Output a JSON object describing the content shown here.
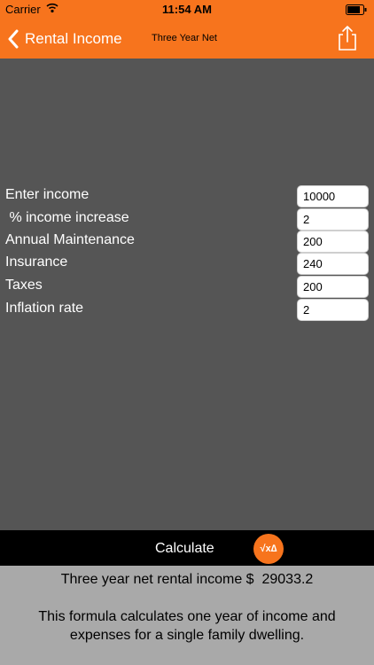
{
  "status_bar": {
    "carrier": "Carrier",
    "time": "11:54 AM"
  },
  "nav": {
    "back_label": "Rental Income",
    "title": "Three Year Net"
  },
  "form": {
    "rows": [
      {
        "label": "Enter income",
        "value": "10000"
      },
      {
        "label": " % income increase",
        "value": "2"
      },
      {
        "label": "Annual Maintenance",
        "value": "200"
      },
      {
        "label": "Insurance",
        "value": "240"
      },
      {
        "label": "Taxes",
        "value": "200"
      },
      {
        "label": "Inflation rate",
        "value": "2"
      }
    ]
  },
  "calculate": {
    "label": "Calculate",
    "icon_text": "√x∆"
  },
  "results": {
    "result_line": "Three year net rental income $  29033.2",
    "description": "This formula calculates one  year of income and expenses for a single family dwelling."
  },
  "colors": {
    "accent": "#f7741d",
    "background": "#555555",
    "results_bg": "#a9a9a9",
    "calc_bar": "#000000"
  }
}
